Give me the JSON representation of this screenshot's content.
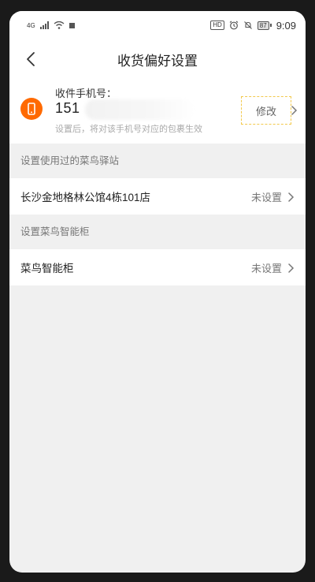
{
  "status_bar": {
    "network": "4G",
    "battery": "87",
    "time": "9:09"
  },
  "nav": {
    "title": "收货偏好设置"
  },
  "phone_card": {
    "label": "收件手机号：",
    "number": "151",
    "note": "设置后，将对该手机号对应的包裹生效",
    "edit_label": "修改"
  },
  "station_section": {
    "header": "设置使用过的菜鸟驿站",
    "row_label": "长沙金地格林公馆4栋101店",
    "row_status": "未设置"
  },
  "locker_section": {
    "header": "设置菜鸟智能柜",
    "row_label": "菜鸟智能柜",
    "row_status": "未设置"
  },
  "colors": {
    "accent": "#ff6a00",
    "edit_border": "#f2c94c",
    "background": "#f0f0f0"
  }
}
